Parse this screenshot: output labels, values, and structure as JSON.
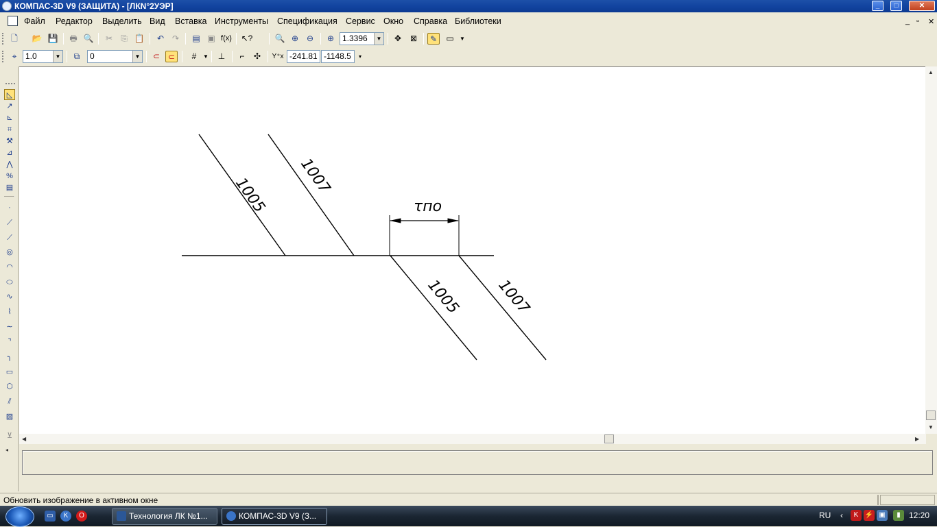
{
  "window": {
    "title": "КОМПАС-3D V9 (ЗАЩИТА) - [ЛКN°2УЭР]",
    "controls": [
      "_",
      "□",
      "✕"
    ]
  },
  "menu": {
    "items": [
      "Файл",
      "Редактор",
      "Выделить",
      "Вид",
      "Вставка",
      "Инструменты",
      "Спецификация",
      "Сервис",
      "Окно",
      "Справка",
      "Библиотеки"
    ],
    "mdi_controls": [
      "_",
      "▫",
      "✕"
    ]
  },
  "toolbar1": {
    "zoom_value": "1.3396",
    "icons": [
      "new-icon",
      "open-icon",
      "save-icon",
      "print-icon",
      "preview-icon",
      "cut-icon",
      "copy-icon",
      "paste-icon",
      "undo-icon",
      "redo-icon",
      "manager-icon",
      "variables-icon",
      "fx-icon",
      "help-pointer-icon",
      "zoom-window-icon",
      "zoom-in-icon",
      "zoom-out-icon",
      "zoom-scale-icon",
      "pan-icon",
      "zoom-all-icon",
      "refresh-icon",
      "panel-icon"
    ]
  },
  "toolbar2": {
    "step_value": "1.0",
    "layer_value": "0",
    "coord_x": "-241.81",
    "coord_y": "-1148.5"
  },
  "drawing": {
    "labels": [
      "1005",
      "1007",
      "1005",
      "1007"
    ],
    "dimension_label": "τпо"
  },
  "status": {
    "text": "Обновить изображение в активном окне"
  },
  "taskbar": {
    "tasks": [
      {
        "label": "Технология ЛК №1..."
      },
      {
        "label": "КОМПАС-3D V9 (З..."
      }
    ],
    "lang": "RU",
    "time": "12:20"
  }
}
